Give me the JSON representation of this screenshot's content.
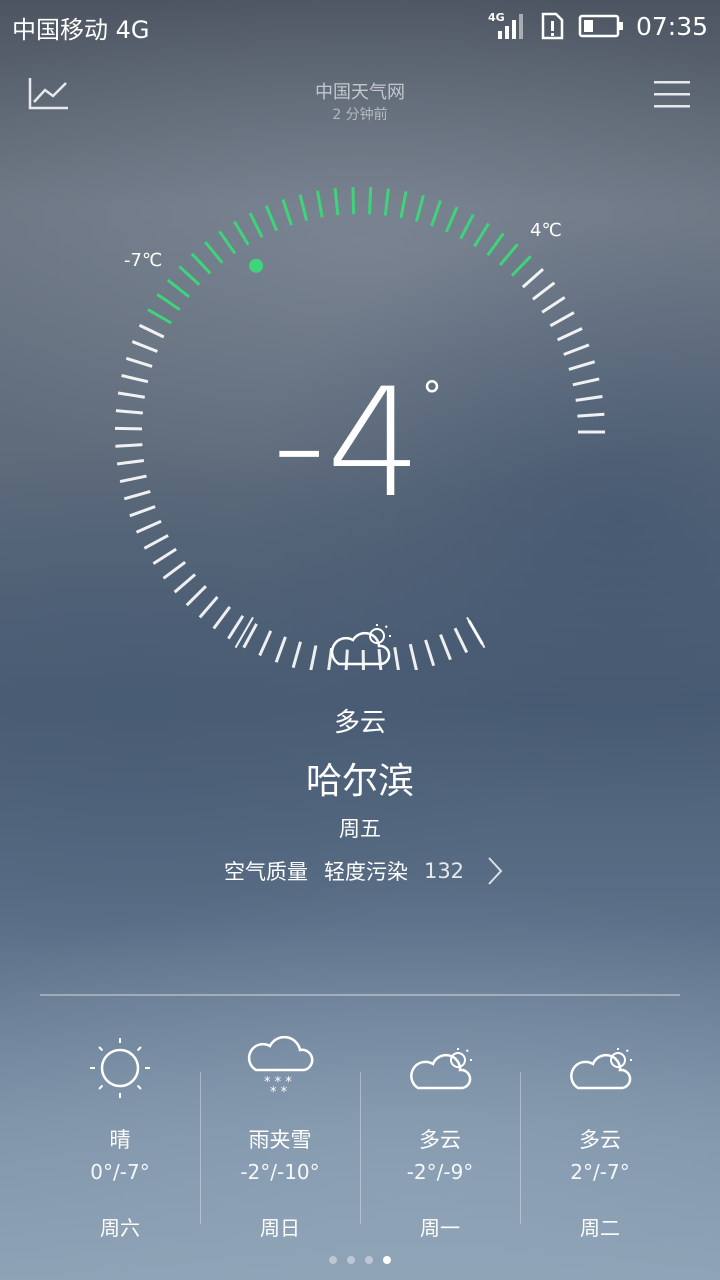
{
  "status_bar": {
    "carrier": "中国移动 4G",
    "network_badge": "4G",
    "time": "07:35",
    "icons": [
      "signal-icon",
      "sim-alert-icon",
      "battery-icon"
    ]
  },
  "header": {
    "source": "中国天气网",
    "updated": "2 分钟前",
    "left_icon": "trend-chart-icon",
    "right_icon": "menu-icon"
  },
  "gauge": {
    "low_label": "-7℃",
    "high_label": "4℃",
    "low": -7,
    "high": 4,
    "current": -4,
    "accent_color": "#3ed47a"
  },
  "current": {
    "temperature": "-4",
    "degree_symbol": "°",
    "icon": "partly-cloudy-icon",
    "condition": "多云",
    "city": "哈尔滨",
    "weekday": "周五",
    "aqi_label": "空气质量",
    "aqi_level": "轻度污染",
    "aqi_value": "132"
  },
  "forecast": [
    {
      "icon": "sun-icon",
      "condition": "晴",
      "range": "0°/-7°",
      "day": "周六"
    },
    {
      "icon": "sleet-icon",
      "condition": "雨夹雪",
      "range": "-2°/-10°",
      "day": "周日"
    },
    {
      "icon": "partly-cloudy-icon",
      "condition": "多云",
      "range": "-2°/-9°",
      "day": "周一"
    },
    {
      "icon": "partly-cloudy-icon",
      "condition": "多云",
      "range": "2°/-7°",
      "day": "周二"
    }
  ],
  "pager": {
    "pages": 4,
    "active": 4
  }
}
